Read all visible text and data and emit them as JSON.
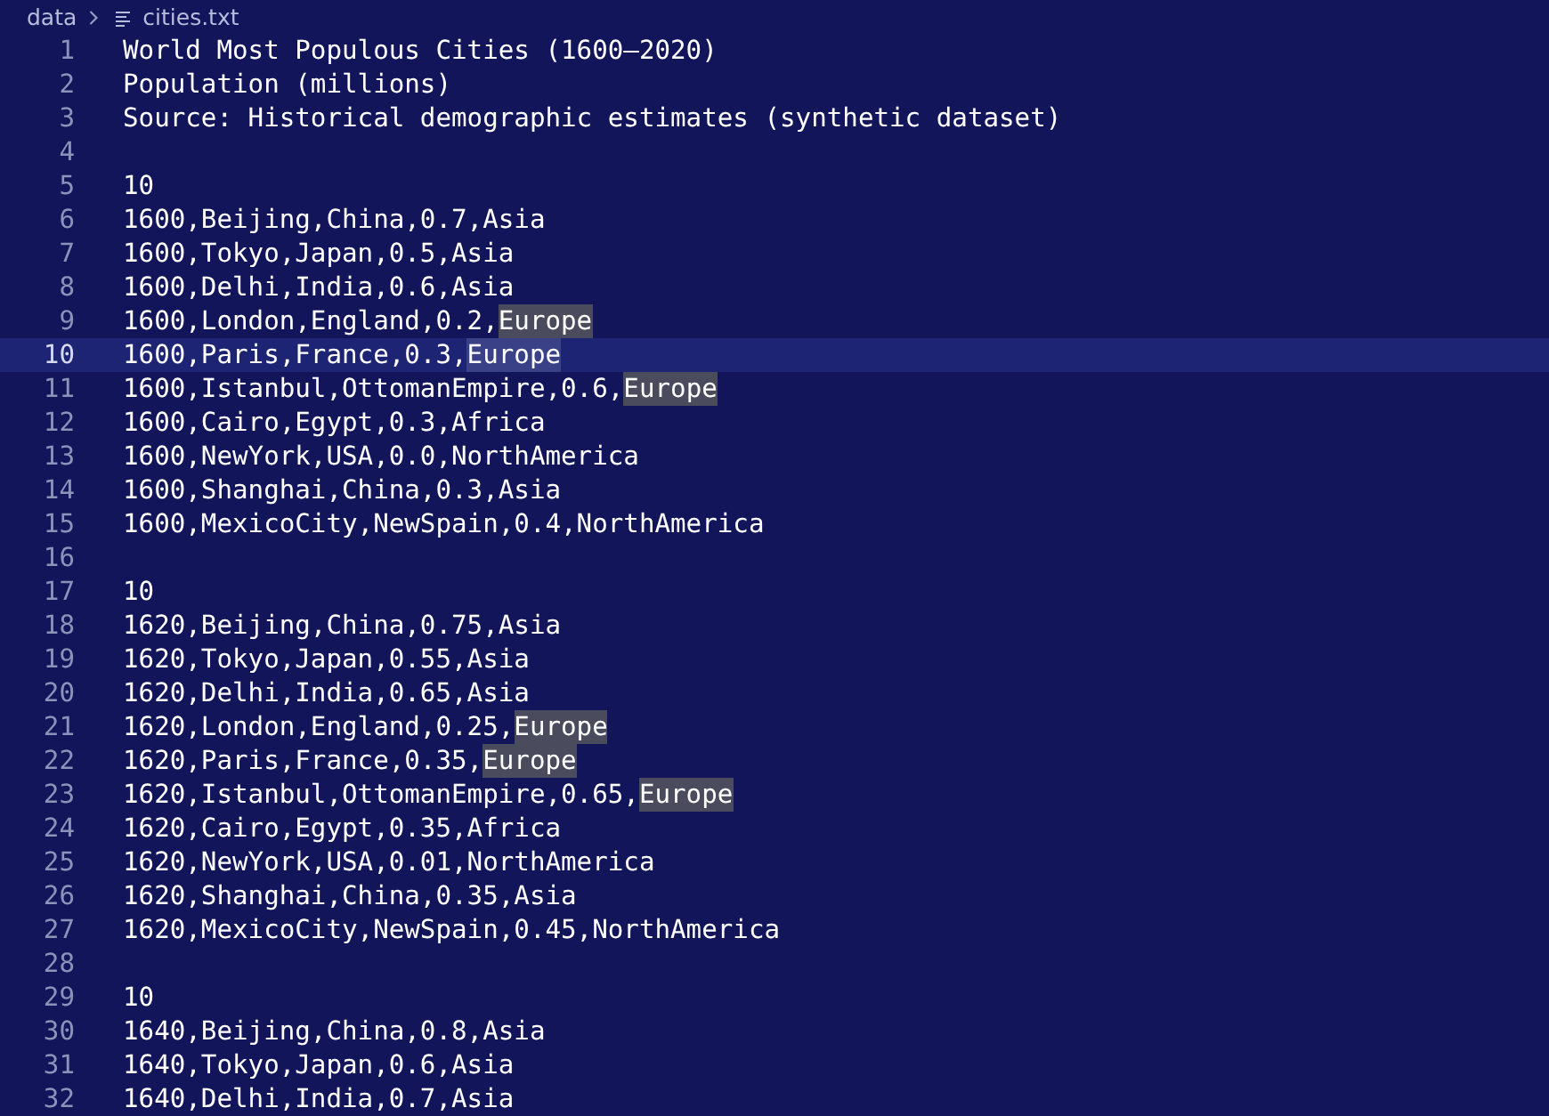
{
  "breadcrumb": [
    {
      "label": "data"
    },
    {
      "label": "cities.txt",
      "kind": "file"
    }
  ],
  "editor": {
    "lines": [
      {
        "number": "1",
        "current": false,
        "segments": [
          {
            "text": "World Most Populous Cities (1600–2020)",
            "kind": "plain"
          }
        ]
      },
      {
        "number": "2",
        "current": false,
        "segments": [
          {
            "text": "Population (millions)",
            "kind": "plain"
          }
        ]
      },
      {
        "number": "3",
        "current": false,
        "segments": [
          {
            "text": "Source: Historical demographic estimates (synthetic dataset)",
            "kind": "plain"
          }
        ]
      },
      {
        "number": "4",
        "current": false
      },
      {
        "number": "5",
        "current": false,
        "segments": [
          {
            "text": "10",
            "kind": "plain"
          }
        ]
      },
      {
        "number": "6",
        "current": false,
        "segments": [
          {
            "text": "1600,Beijing,China,0.7,Asia",
            "kind": "plain"
          }
        ]
      },
      {
        "number": "7",
        "current": false,
        "segments": [
          {
            "text": "1600,Tokyo,Japan,0.5,Asia",
            "kind": "plain"
          }
        ]
      },
      {
        "number": "8",
        "current": false,
        "segments": [
          {
            "text": "1600,Delhi,India,0.6,Asia",
            "kind": "plain"
          }
        ]
      },
      {
        "number": "9",
        "current": false,
        "segments": [
          {
            "text": "1600,London,England,0.2,",
            "kind": "plain"
          },
          {
            "text": "Europe",
            "kind": "match"
          }
        ]
      },
      {
        "number": "10",
        "current": true,
        "segments": [
          {
            "text": "1600,Paris,France,0.3,",
            "kind": "plain"
          },
          {
            "text": "Europe",
            "kind": "selection"
          }
        ]
      },
      {
        "number": "11",
        "current": false,
        "segments": [
          {
            "text": "1600,Istanbul,OttomanEmpire,0.6,",
            "kind": "plain"
          },
          {
            "text": "Europe",
            "kind": "match"
          }
        ]
      },
      {
        "number": "12",
        "current": false,
        "segments": [
          {
            "text": "1600,Cairo,Egypt,0.3,Africa",
            "kind": "plain"
          }
        ]
      },
      {
        "number": "13",
        "current": false,
        "segments": [
          {
            "text": "1600,NewYork,USA,0.0,NorthAmerica",
            "kind": "plain"
          }
        ]
      },
      {
        "number": "14",
        "current": false,
        "segments": [
          {
            "text": "1600,Shanghai,China,0.3,Asia",
            "kind": "plain"
          }
        ]
      },
      {
        "number": "15",
        "current": false,
        "segments": [
          {
            "text": "1600,MexicoCity,NewSpain,0.4,NorthAmerica",
            "kind": "plain"
          }
        ]
      },
      {
        "number": "16",
        "current": false
      },
      {
        "number": "17",
        "current": false,
        "segments": [
          {
            "text": "10",
            "kind": "plain"
          }
        ]
      },
      {
        "number": "18",
        "current": false,
        "segments": [
          {
            "text": "1620,Beijing,China,0.75,Asia",
            "kind": "plain"
          }
        ]
      },
      {
        "number": "19",
        "current": false,
        "segments": [
          {
            "text": "1620,Tokyo,Japan,0.55,Asia",
            "kind": "plain"
          }
        ]
      },
      {
        "number": "20",
        "current": false,
        "segments": [
          {
            "text": "1620,Delhi,India,0.65,Asia",
            "kind": "plain"
          }
        ]
      },
      {
        "number": "21",
        "current": false,
        "segments": [
          {
            "text": "1620,London,England,0.25,",
            "kind": "plain"
          },
          {
            "text": "Europe",
            "kind": "match"
          }
        ]
      },
      {
        "number": "22",
        "current": false,
        "segments": [
          {
            "text": "1620,Paris,France,0.35,",
            "kind": "plain"
          },
          {
            "text": "Europe",
            "kind": "match"
          }
        ]
      },
      {
        "number": "23",
        "current": false,
        "segments": [
          {
            "text": "1620,Istanbul,OttomanEmpire,0.65,",
            "kind": "plain"
          },
          {
            "text": "Europe",
            "kind": "match"
          }
        ]
      },
      {
        "number": "24",
        "current": false,
        "segments": [
          {
            "text": "1620,Cairo,Egypt,0.35,Africa",
            "kind": "plain"
          }
        ]
      },
      {
        "number": "25",
        "current": false,
        "segments": [
          {
            "text": "1620,NewYork,USA,0.01,NorthAmerica",
            "kind": "plain"
          }
        ]
      },
      {
        "number": "26",
        "current": false,
        "segments": [
          {
            "text": "1620,Shanghai,China,0.35,Asia",
            "kind": "plain"
          }
        ]
      },
      {
        "number": "27",
        "current": false,
        "segments": [
          {
            "text": "1620,MexicoCity,NewSpain,0.45,NorthAmerica",
            "kind": "plain"
          }
        ]
      },
      {
        "number": "28",
        "current": false
      },
      {
        "number": "29",
        "current": false,
        "segments": [
          {
            "text": "10",
            "kind": "plain"
          }
        ]
      },
      {
        "number": "30",
        "current": false,
        "segments": [
          {
            "text": "1640,Beijing,China,0.8,Asia",
            "kind": "plain"
          }
        ]
      },
      {
        "number": "31",
        "current": false,
        "segments": [
          {
            "text": "1640,Tokyo,Japan,0.6,Asia",
            "kind": "plain"
          }
        ]
      },
      {
        "number": "32",
        "current": false,
        "segments": [
          {
            "text": "1640,Delhi,India,0.7,Asia",
            "kind": "plain"
          }
        ]
      }
    ]
  }
}
